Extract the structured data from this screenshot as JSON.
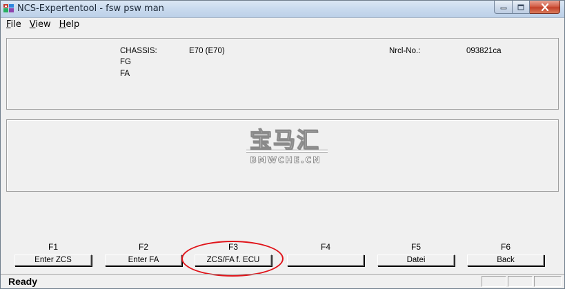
{
  "window": {
    "title": "NCS-Expertentool - fsw psw man",
    "icon": "ncs-app-icon"
  },
  "menu": [
    {
      "underline": "F",
      "rest": "ile"
    },
    {
      "underline": "V",
      "rest": "iew"
    },
    {
      "underline": "H",
      "rest": "elp"
    }
  ],
  "vehicle": {
    "chassis_label": "CHASSIS:",
    "chassis_value": "E70 (E70)",
    "fg_label": "FG",
    "fa_label": "FA",
    "nrcl_label": "Nrcl-No.:",
    "nrcl_value": "093821ca"
  },
  "watermark": {
    "cn": "宝马汇",
    "en": "BMWCHE.CN"
  },
  "function_keys": [
    {
      "key": "F1",
      "label": "Enter ZCS"
    },
    {
      "key": "F2",
      "label": "Enter FA"
    },
    {
      "key": "F3",
      "label": "ZCS/FA f. ECU"
    },
    {
      "key": "F4",
      "label": ""
    },
    {
      "key": "F5",
      "label": "Datei"
    },
    {
      "key": "F6",
      "label": "Back"
    }
  ],
  "status": {
    "text": "Ready"
  },
  "colors": {
    "highlight_ellipse": "#e0141a",
    "window_bg": "#f0f0f0"
  }
}
